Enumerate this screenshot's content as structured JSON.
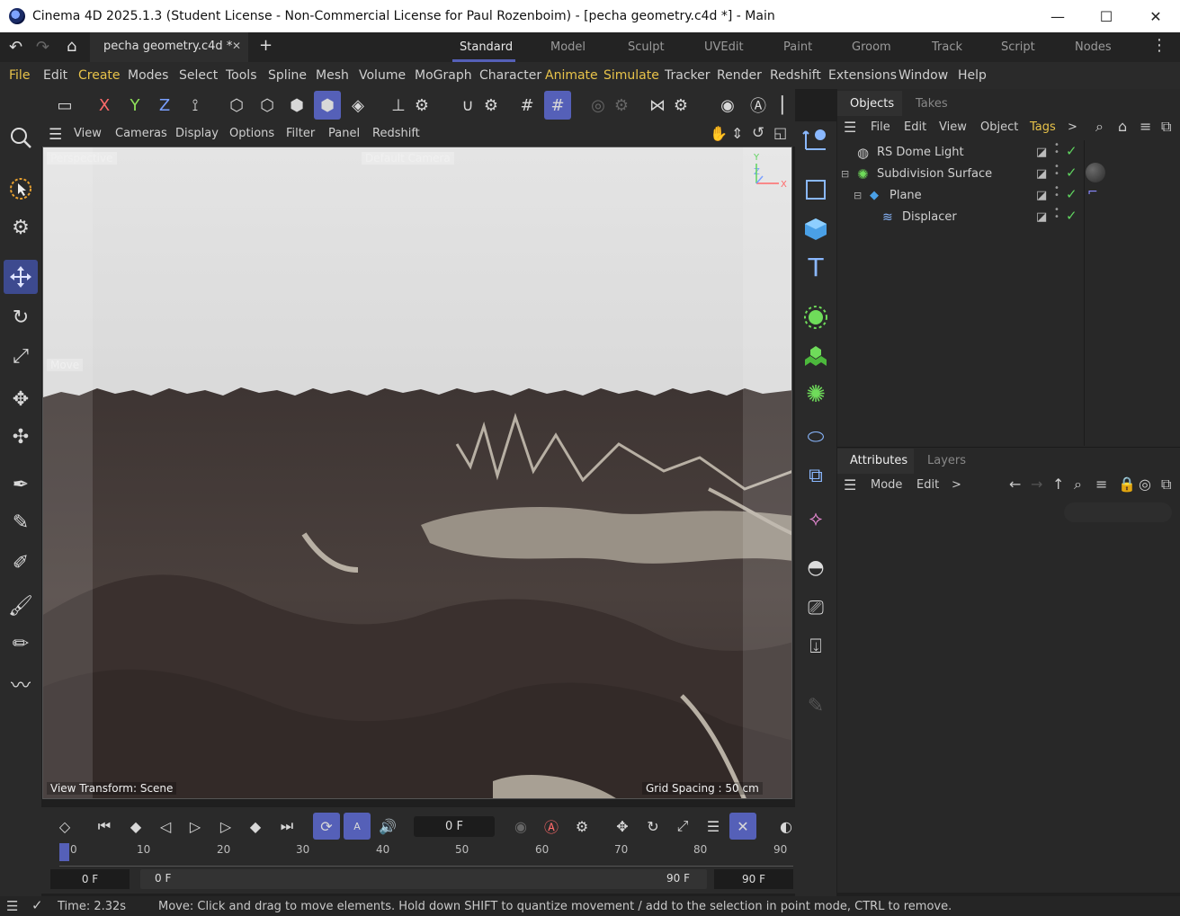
{
  "window": {
    "title": "Cinema 4D 2025.1.3 (Student License - Non-Commercial License for Paul Rozenboim) - [pecha geometry.c4d *] - Main",
    "minimize": "—",
    "maximize": "☐",
    "close": "✕"
  },
  "tabbar": {
    "doc_tab": "pecha geometry.c4d *",
    "doc_close": "✕",
    "new_tab": "+",
    "workspaces": [
      "Standard",
      "Model",
      "Sculpt",
      "UVEdit",
      "Paint",
      "Groom",
      "Track",
      "Script",
      "Nodes"
    ],
    "active_workspace": "Standard"
  },
  "menubar": [
    "File",
    "Edit",
    "Create",
    "Modes",
    "Select",
    "Tools",
    "Spline",
    "Mesh",
    "Volume",
    "MoGraph",
    "Character",
    "Animate",
    "Simulate",
    "Tracker",
    "Render",
    "Redshift",
    "Extensions",
    "Window",
    "Help"
  ],
  "accent_menus": [
    "File",
    "Create",
    "Animate",
    "Simulate"
  ],
  "toolbar": {
    "x": "X",
    "y": "Y",
    "z": "Z"
  },
  "viewport_menu": [
    "View",
    "Cameras",
    "Display",
    "Options",
    "Filter",
    "Panel",
    "Redshift"
  ],
  "viewport": {
    "projection": "Perspective",
    "camera": "Default Camera",
    "tool_label": "Move",
    "view_transform": "View Transform: Scene",
    "grid_spacing": "Grid Spacing : 50 cm",
    "axis_y": "Y",
    "axis_z": "Z",
    "axis_x": "X"
  },
  "objects_panel": {
    "tabs": [
      "Objects",
      "Takes"
    ],
    "menu": [
      "File",
      "Edit",
      "View",
      "Object",
      "Tags"
    ],
    "more": ">",
    "items": [
      {
        "name": "RS Dome Light"
      },
      {
        "name": "Subdivision Surface"
      },
      {
        "name": "Plane"
      },
      {
        "name": "Displacer"
      }
    ]
  },
  "attributes_panel": {
    "tabs": [
      "Attributes",
      "Layers"
    ],
    "menu": [
      "Mode",
      "Edit"
    ],
    "more": ">"
  },
  "timeline": {
    "current_frame": "0 F",
    "ruler": [
      "0",
      "10",
      "20",
      "30",
      "40",
      "50",
      "60",
      "70",
      "80",
      "90"
    ],
    "start": "0 F",
    "range_start": "0 F",
    "range_end": "90 F",
    "end": "90 F"
  },
  "status": {
    "time": "Time: 2.32s",
    "message": "Move: Click and drag to move elements. Hold down SHIFT to quantize movement / add to the selection in point mode, CTRL to remove."
  },
  "colors": {
    "accent_menu": "#e8c34a",
    "active_blue": "#5560b8",
    "check_green": "#5fd35f"
  }
}
